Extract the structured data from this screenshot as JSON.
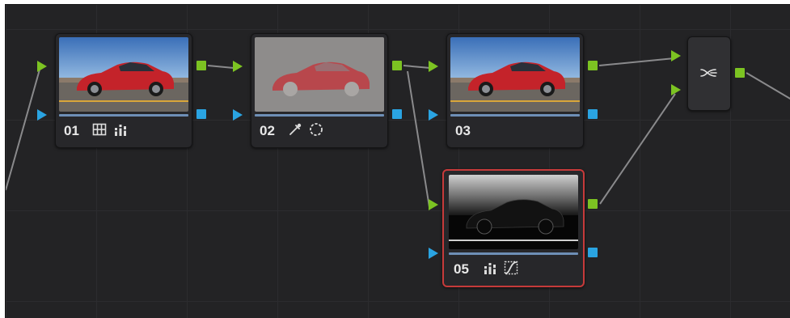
{
  "nodes": [
    {
      "id": "01",
      "label": "01",
      "tools": [
        "grid-icon",
        "bars-icon"
      ],
      "selected": false
    },
    {
      "id": "02",
      "label": "02",
      "tools": [
        "eyedropper-icon",
        "window-circle-icon"
      ],
      "selected": false
    },
    {
      "id": "03",
      "label": "03",
      "tools": [],
      "selected": false
    },
    {
      "id": "05",
      "label": "05",
      "tools": [
        "bars-icon",
        "curves-icon"
      ],
      "selected": true
    }
  ],
  "mixer": {
    "icon": "layer-mixer-icon"
  },
  "colors": {
    "rgb_port": "#7cc322",
    "key_port": "#2aa4e2",
    "selected_outline": "#c63a3a",
    "background": "#232325"
  }
}
